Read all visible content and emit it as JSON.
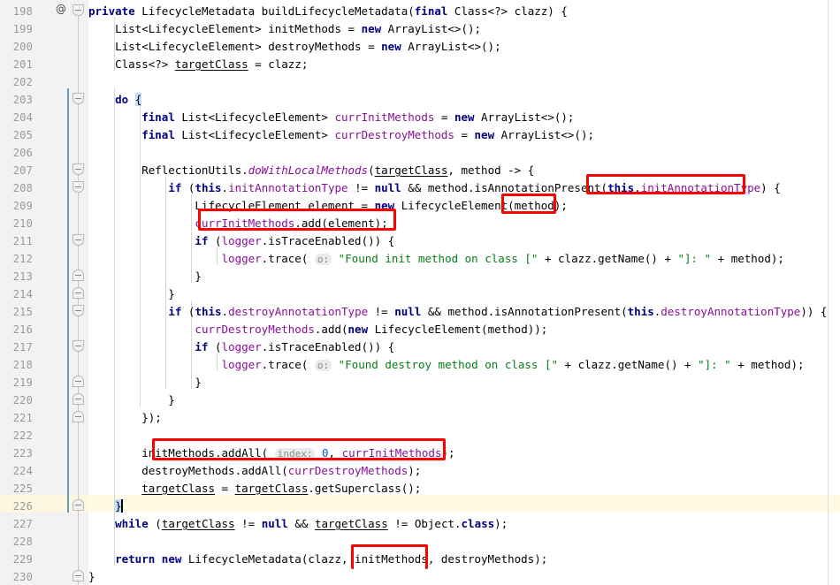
{
  "app": {
    "kind": "code-editor",
    "language": "Java",
    "theme": "IntelliJ Light"
  },
  "colors": {
    "background": "#ffffff",
    "gutter_background": "#f2f2f2",
    "line_number": "#999999",
    "keyword": "#000080",
    "field": "#871094",
    "string": "#067d17",
    "number": "#1750eb",
    "text": "#000000",
    "current_line": "#fffae3",
    "annotation_box": "#ff0000",
    "change_marker": "#6897bb",
    "indent_guide": "#d6d6d6",
    "right_margin": "#e0e0e0",
    "inlay_hint_bg": "#eaeaea",
    "inlay_hint_fg": "#8c8c8c"
  },
  "gutter": {
    "annotation_icon": "@",
    "annotation_icon_name": "java-annotation-gutter-icon",
    "first_line": 198,
    "last_line": 230,
    "current_line": 226,
    "line_numbers": [
      198,
      199,
      200,
      201,
      202,
      203,
      204,
      205,
      206,
      207,
      208,
      209,
      210,
      211,
      212,
      213,
      214,
      215,
      216,
      217,
      218,
      219,
      220,
      221,
      222,
      223,
      224,
      225,
      226,
      227,
      228,
      229,
      230
    ]
  },
  "annotations": {
    "description": "Red rectangles drawn over code fragments",
    "boxes": [
      {
        "id": 1,
        "target_line": 208,
        "text": "(this.initAnnotationType)"
      },
      {
        "id": 2,
        "target_line": 209,
        "text": "(method);"
      },
      {
        "id": 3,
        "target_line": 210,
        "text": "currInitMethods.add(element);"
      },
      {
        "id": 4,
        "target_line": 223,
        "text": "initMethods.addAll( index: 0, currInitMethods);"
      },
      {
        "id": 5,
        "target_line": 229,
        "text": "initMethods,"
      }
    ]
  },
  "inlay_hints": [
    {
      "line": 212,
      "label": "o:"
    },
    {
      "line": 218,
      "label": "o:"
    },
    {
      "line": 223,
      "label": "index:"
    }
  ],
  "code": {
    "lines": [
      {
        "n": 198,
        "text": "private LifecycleMetadata buildLifecycleMetadata(final Class<?> clazz) {"
      },
      {
        "n": 199,
        "text": "    List<LifecycleElement> initMethods = new ArrayList<>();"
      },
      {
        "n": 200,
        "text": "    List<LifecycleElement> destroyMethods = new ArrayList<>();"
      },
      {
        "n": 201,
        "text": "    Class<?> targetClass = clazz;"
      },
      {
        "n": 202,
        "text": ""
      },
      {
        "n": 203,
        "text": "    do {"
      },
      {
        "n": 204,
        "text": "        final List<LifecycleElement> currInitMethods = new ArrayList<>();"
      },
      {
        "n": 205,
        "text": "        final List<LifecycleElement> currDestroyMethods = new ArrayList<>();"
      },
      {
        "n": 206,
        "text": ""
      },
      {
        "n": 207,
        "text": "        ReflectionUtils.doWithLocalMethods(targetClass, method -> {"
      },
      {
        "n": 208,
        "text": "            if (this.initAnnotationType != null && method.isAnnotationPresent(this.initAnnotationType) {"
      },
      {
        "n": 209,
        "text": "                LifecycleElement element = new LifecycleElement(method);"
      },
      {
        "n": 210,
        "text": "                currInitMethods.add(element);"
      },
      {
        "n": 211,
        "text": "                if (logger.isTraceEnabled()) {"
      },
      {
        "n": 212,
        "text": "                    logger.trace( o: \"Found init method on class [\" + clazz.getName() + \"]: \" + method);"
      },
      {
        "n": 213,
        "text": "                }"
      },
      {
        "n": 214,
        "text": "            }"
      },
      {
        "n": 215,
        "text": "            if (this.destroyAnnotationType != null && method.isAnnotationPresent(this.destroyAnnotationType)) {"
      },
      {
        "n": 216,
        "text": "                currDestroyMethods.add(new LifecycleElement(method));"
      },
      {
        "n": 217,
        "text": "                if (logger.isTraceEnabled()) {"
      },
      {
        "n": 218,
        "text": "                    logger.trace( o: \"Found destroy method on class [\" + clazz.getName() + \"]: \" + method);"
      },
      {
        "n": 219,
        "text": "                }"
      },
      {
        "n": 220,
        "text": "            }"
      },
      {
        "n": 221,
        "text": "        });"
      },
      {
        "n": 222,
        "text": ""
      },
      {
        "n": 223,
        "text": "        initMethods.addAll( index: 0, currInitMethods);"
      },
      {
        "n": 224,
        "text": "        destroyMethods.addAll(currDestroyMethods);"
      },
      {
        "n": 225,
        "text": "        targetClass = targetClass.getSuperclass();"
      },
      {
        "n": 226,
        "text": "    }"
      },
      {
        "n": 227,
        "text": "    while (targetClass != null && targetClass != Object.class);"
      },
      {
        "n": 228,
        "text": ""
      },
      {
        "n": 229,
        "text": "    return new LifecycleMetadata(clazz, initMethods, destroyMethods);"
      },
      {
        "n": 230,
        "text": "}"
      }
    ]
  }
}
